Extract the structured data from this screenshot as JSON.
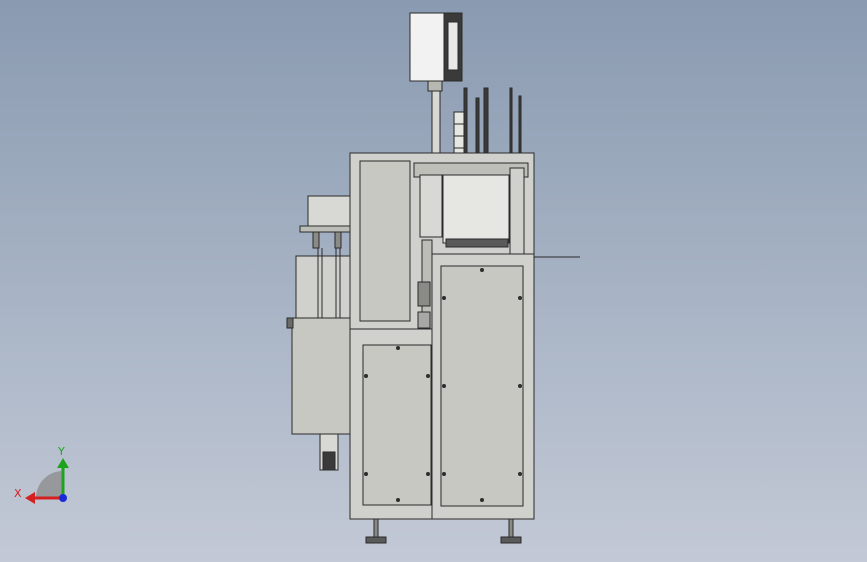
{
  "viewport": {
    "background_top": "#8a9ab0",
    "background_bottom": "#c3c9d6"
  },
  "model": {
    "panel_fill": "#c8c8c2",
    "frame_fill": "#d0d0cc",
    "edge_color": "#2a2a2a"
  },
  "triad": {
    "x_label": "X",
    "y_label": "Y",
    "x_color": "#d42020",
    "y_color": "#1fa31f",
    "z_color": "#1a2ad8"
  }
}
